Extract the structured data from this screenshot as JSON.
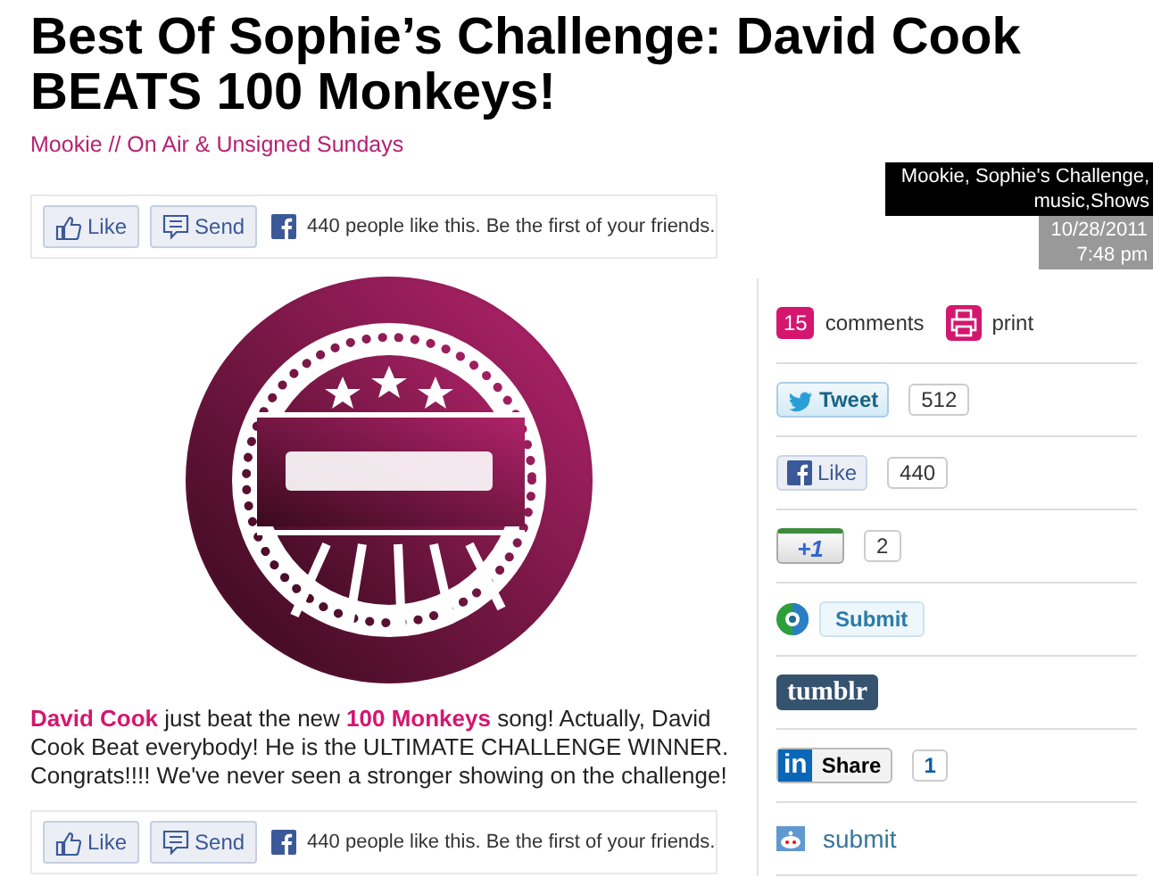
{
  "title": "Best Of Sophie’s Challenge: David Cook BEATS 100 Monkeys!",
  "byline": "Mookie // On Air & Unsigned Sundays",
  "tags": "Mookie, Sophie's Challenge, music,Shows",
  "date": "10/28/2011",
  "time": "7:48 pm",
  "like_bars": [
    {
      "like": "Like",
      "send": "Send",
      "text": "440 people like this. Be the first of your friends."
    },
    {
      "like": "Like",
      "send": "Send",
      "text": "440 people like this. Be the first of your friends."
    }
  ],
  "body": "**David Cook** just beat the new **100 Monkeys** song! Actually, David Cook Beat everybody! He is the ULTIMATE CHALLENGE WINNER. Congrats!!!! We've never seen a stronger showing on the challenge!",
  "comments": {
    "count": "15",
    "label": "comments"
  },
  "print": "print",
  "share": [
    {
      "kind": "tweet",
      "label": "Tweet",
      "count": "512"
    },
    {
      "kind": "facebook",
      "label": "Like",
      "count": "440"
    },
    {
      "kind": "plusone",
      "label": "+1",
      "count": "2"
    },
    {
      "kind": "stumble",
      "label": "Submit"
    },
    {
      "kind": "tumblr",
      "label": "tumblr"
    },
    {
      "kind": "linkedin",
      "badge": "in",
      "label": "Share",
      "count": "1"
    },
    {
      "kind": "reddit",
      "label": "submit"
    }
  ]
}
